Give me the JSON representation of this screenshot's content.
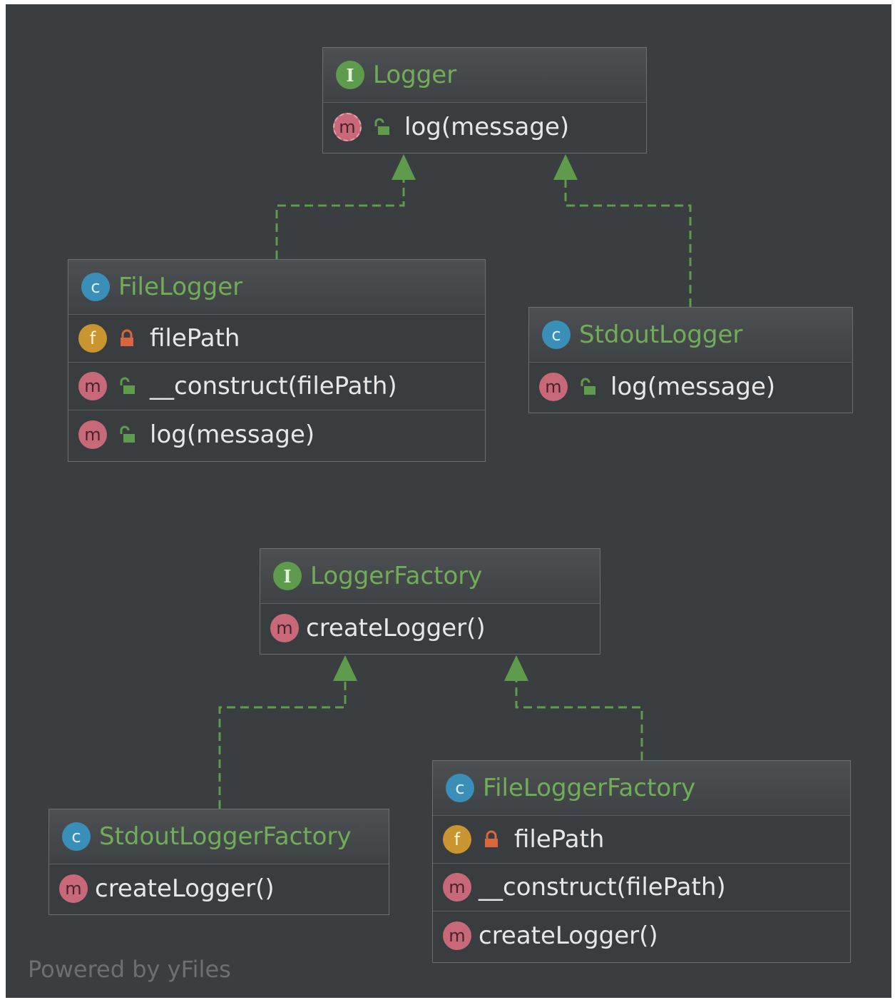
{
  "colors": {
    "canvas": "#3b3e41",
    "title": "#6fae56",
    "edge": "#5e9b4c",
    "interface_badge": "#5e9b4c",
    "class_badge": "#3a8fb8",
    "field_badge": "#c89530",
    "method_badge": "#c8697a",
    "text": "#e7e7e7"
  },
  "nodes": {
    "logger": {
      "kind": "interface",
      "badge": "I",
      "title": "Logger",
      "members": [
        {
          "kind": "abstract-method",
          "badge": "m",
          "visibility": "public",
          "text": "log(message)"
        }
      ]
    },
    "file_logger": {
      "kind": "class",
      "badge": "c",
      "title": "FileLogger",
      "members": [
        {
          "kind": "field",
          "badge": "f",
          "visibility": "private",
          "text": "filePath"
        },
        {
          "kind": "method",
          "badge": "m",
          "visibility": "public",
          "text": "__construct(filePath)"
        },
        {
          "kind": "method",
          "badge": "m",
          "visibility": "public",
          "text": "log(message)"
        }
      ]
    },
    "stdout_logger": {
      "kind": "class",
      "badge": "c",
      "title": "StdoutLogger",
      "members": [
        {
          "kind": "method",
          "badge": "m",
          "visibility": "public",
          "text": "log(message)"
        }
      ]
    },
    "logger_factory": {
      "kind": "interface",
      "badge": "I",
      "title": "LoggerFactory",
      "members": [
        {
          "kind": "method",
          "badge": "m",
          "text": "createLogger()"
        }
      ]
    },
    "stdout_logger_factory": {
      "kind": "class",
      "badge": "c",
      "title": "StdoutLoggerFactory",
      "members": [
        {
          "kind": "method",
          "badge": "m",
          "text": "createLogger()"
        }
      ]
    },
    "file_logger_factory": {
      "kind": "class",
      "badge": "c",
      "title": "FileLoggerFactory",
      "members": [
        {
          "kind": "field",
          "badge": "f",
          "visibility": "private",
          "text": "filePath"
        },
        {
          "kind": "method",
          "badge": "m",
          "text": "__construct(filePath)"
        },
        {
          "kind": "method",
          "badge": "m",
          "text": "createLogger()"
        }
      ]
    }
  },
  "edges": [
    {
      "from": "FileLogger",
      "to": "Logger",
      "type": "implements"
    },
    {
      "from": "StdoutLogger",
      "to": "Logger",
      "type": "implements"
    },
    {
      "from": "StdoutLoggerFactory",
      "to": "LoggerFactory",
      "type": "implements"
    },
    {
      "from": "FileLoggerFactory",
      "to": "LoggerFactory",
      "type": "implements"
    }
  ],
  "watermark": "Powered by yFiles"
}
